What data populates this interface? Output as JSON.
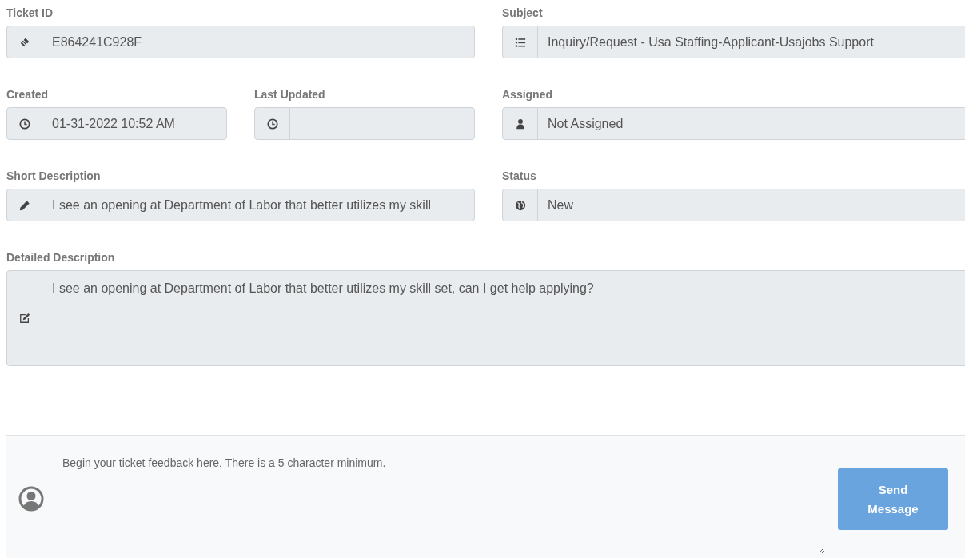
{
  "fields": [
    {
      "label": "Ticket ID",
      "value": "E864241C928F"
    },
    {
      "label": "Subject",
      "value": "Inquiry/Request - Usa Staffing-Applicant-Usajobs Support"
    },
    {
      "label": "Created",
      "value": "01-31-2022 10:52 AM"
    },
    {
      "label": "Last Updated"
    },
    {
      "label": "Assigned",
      "value": "Not Assigned"
    },
    {
      "label": "Short Description",
      "value": "I see an opening at Department of Labor that better utilizes my skill"
    },
    {
      "label": "Status",
      "value": "New"
    }
  ],
  "detailed_description": {
    "label": "Detailed Description",
    "value": "I see an opening at Department of Labor that better utilizes my skill set, can I get help applying?"
  },
  "feedback": {
    "placeholder": "Begin your ticket feedback here. There is a 5 character minimum.",
    "send_button": {
      "label": "Send Message",
      "disabled": true
    }
  }
}
